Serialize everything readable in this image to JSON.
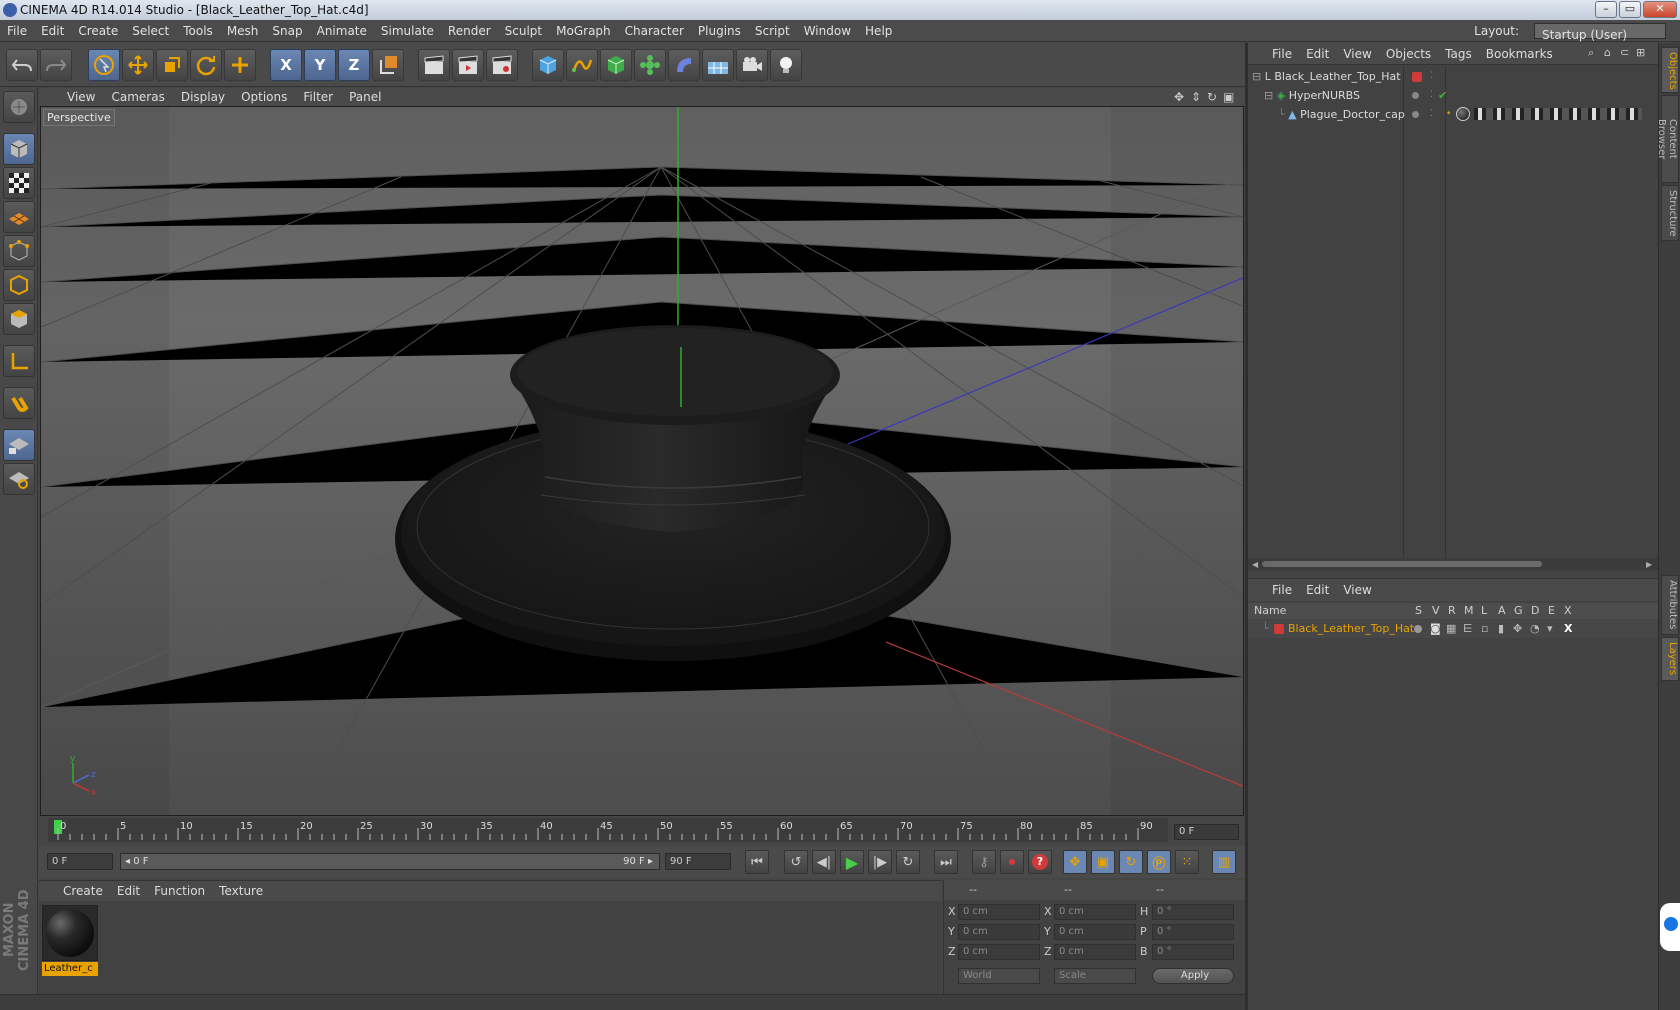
{
  "window": {
    "title": "CINEMA 4D R14.014 Studio - [Black_Leather_Top_Hat.c4d]"
  },
  "menu": [
    "File",
    "Edit",
    "Create",
    "Select",
    "Tools",
    "Mesh",
    "Snap",
    "Animate",
    "Simulate",
    "Render",
    "Sculpt",
    "MoGraph",
    "Character",
    "Plugins",
    "Script",
    "Window",
    "Help"
  ],
  "layout": {
    "label": "Layout:",
    "value": "Startup (User)"
  },
  "toolbar": {
    "x_label": "X",
    "y_label": "Y",
    "z_label": "Z"
  },
  "viewport": {
    "menu": [
      "View",
      "Cameras",
      "Display",
      "Options",
      "Filter",
      "Panel"
    ],
    "label": "Perspective",
    "axis": {
      "y": "y",
      "z": "z",
      "x": "x"
    }
  },
  "timeline": {
    "ticks": [
      "0",
      "5",
      "10",
      "15",
      "20",
      "25",
      "30",
      "35",
      "40",
      "45",
      "50",
      "55",
      "60",
      "65",
      "70",
      "75",
      "80",
      "85",
      "90"
    ],
    "current_frame": "0 F",
    "start_field": "0 F",
    "range_start": "◂ 0 F",
    "range_end": "90 F ▸",
    "end_field": "90 F"
  },
  "materials": {
    "menu": [
      "Create",
      "Edit",
      "Function",
      "Texture"
    ],
    "items": [
      {
        "name": "Leather_c"
      }
    ]
  },
  "coordinates": {
    "header": [
      "--",
      "--",
      "--"
    ],
    "rows": [
      {
        "l1": "X",
        "v1": "0 cm",
        "l2": "X",
        "v2": "0 cm",
        "l3": "H",
        "v3": "0 °"
      },
      {
        "l1": "Y",
        "v1": "0 cm",
        "l2": "Y",
        "v2": "0 cm",
        "l3": "P",
        "v3": "0 °"
      },
      {
        "l1": "Z",
        "v1": "0 cm",
        "l2": "Z",
        "v2": "0 cm",
        "l3": "B",
        "v3": "0 °"
      }
    ],
    "mode": "World",
    "scale": "Scale",
    "apply": "Apply"
  },
  "objects": {
    "menu": [
      "File",
      "Edit",
      "View",
      "Objects",
      "Tags",
      "Bookmarks"
    ],
    "tree": [
      {
        "name": "Black_Leather_Top_Hat"
      },
      {
        "name": "HyperNURBS"
      },
      {
        "name": "Plague_Doctor_cap"
      }
    ]
  },
  "layers": {
    "menu": [
      "File",
      "Edit",
      "View"
    ],
    "columns": {
      "name": "Name",
      "flags": [
        "S",
        "V",
        "R",
        "M",
        "L",
        "A",
        "G",
        "D",
        "E",
        "X"
      ]
    },
    "rows": [
      {
        "name": "Black_Leather_Top_Hat"
      }
    ]
  },
  "sidetabs": [
    "Objects",
    "Content Browser",
    "Structure",
    "Attributes",
    "Layers"
  ],
  "colors": {
    "accent": "#e9a300",
    "selected_blue": "#5f7fb0",
    "layer_red": "#d23a3a"
  }
}
